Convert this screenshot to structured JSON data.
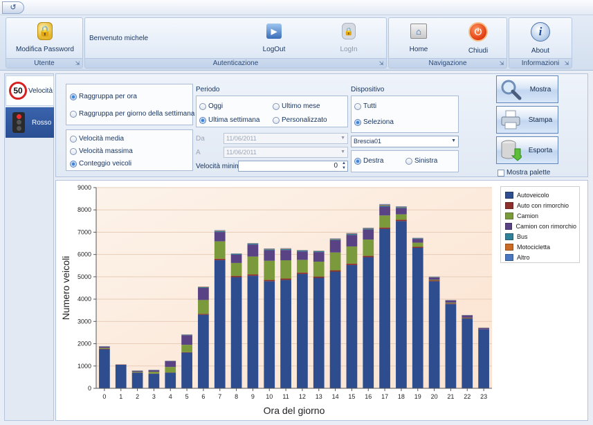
{
  "ribbon": {
    "groups": {
      "utente": "Utente",
      "autenticazione": "Autenticazione",
      "navigazione": "Navigazione",
      "informazioni": "Informazioni"
    },
    "buttons": {
      "modifica_password": "Modifica Password",
      "logout": "LogOut",
      "login": "LogIn",
      "home": "Home",
      "chiudi": "Chiudi",
      "about": "About"
    },
    "welcome": "Benvenuto michele"
  },
  "nav": {
    "velocita": "Velocità",
    "sign_value": "50",
    "rosso": "Rosso"
  },
  "filters": {
    "grouping": {
      "per_ora": "Raggruppa per ora",
      "per_giorno": "Raggruppa per giorno della settimana",
      "selected": "per_ora"
    },
    "metric": {
      "velocita_media": "Velocità media",
      "velocita_massima": "Velocità massima",
      "conteggio_veicoli": "Conteggio veicoli",
      "selected": "conteggio_veicoli"
    },
    "periodo": {
      "title": "Periodo",
      "oggi": "Oggi",
      "ultimo_mese": "Ultimo mese",
      "ultima_settimana": "Ultima settimana",
      "personalizzato": "Personalizzato",
      "selected": "ultima_settimana",
      "da_label": "Da",
      "a_label": "A",
      "da_value": "11/06/2011",
      "a_value": "11/06/2011",
      "velocita_minima_label": "Velocità minima",
      "velocita_minima_value": "0"
    },
    "dispositivo": {
      "title": "Dispositivo",
      "tutti": "Tutti",
      "seleziona": "Seleziona",
      "selected": "seleziona",
      "device_value": "Brescia01",
      "destra": "Destra",
      "sinistra": "Sinistra",
      "direction_selected": "destra"
    }
  },
  "actions": {
    "mostra": "Mostra",
    "stampa": "Stampa",
    "esporta": "Esporta",
    "mostra_palette": "Mostra palette"
  },
  "colors": {
    "autoveicolo": "#2e4d8f",
    "auto_con_rimorchio": "#8c2f2a",
    "camion": "#7b9a3c",
    "camion_con_rimorchio": "#5a4384",
    "bus": "#2f7f96",
    "motocicletta": "#c96a25",
    "altro": "#4a78c0"
  },
  "chart_data": {
    "type": "bar",
    "stacked": true,
    "xlabel": "Ora del giorno",
    "ylabel": "Numero veicoli",
    "ylim": [
      0,
      9000
    ],
    "yticks": [
      0,
      1000,
      2000,
      3000,
      4000,
      5000,
      6000,
      7000,
      8000,
      9000
    ],
    "categories": [
      "0",
      "1",
      "2",
      "3",
      "4",
      "5",
      "6",
      "7",
      "8",
      "9",
      "10",
      "11",
      "12",
      "13",
      "14",
      "15",
      "16",
      "17",
      "18",
      "19",
      "20",
      "21",
      "22",
      "23"
    ],
    "grid": true,
    "legend": "top-right",
    "series": [
      {
        "name": "Autoveicolo",
        "values": [
          1750,
          1060,
          700,
          650,
          700,
          1600,
          3300,
          5750,
          4980,
          5050,
          4800,
          4860,
          5130,
          4950,
          5230,
          5530,
          5880,
          7150,
          7500,
          6300,
          4800,
          3780,
          3130,
          2650
        ]
      },
      {
        "name": "Auto con rimorchio",
        "values": [
          20,
          10,
          10,
          10,
          10,
          20,
          40,
          60,
          60,
          60,
          60,
          60,
          60,
          60,
          60,
          60,
          60,
          60,
          60,
          50,
          40,
          30,
          20,
          10
        ]
      },
      {
        "name": "Camion",
        "values": [
          40,
          0,
          30,
          80,
          250,
          330,
          620,
          780,
          580,
          800,
          860,
          820,
          570,
          670,
          800,
          770,
          730,
          540,
          240,
          180,
          30,
          30,
          20,
          0
        ]
      },
      {
        "name": "Camion con rimorchio",
        "values": [
          60,
          0,
          40,
          70,
          260,
          430,
          540,
          420,
          370,
          540,
          470,
          460,
          380,
          430,
          550,
          520,
          450,
          400,
          280,
          170,
          100,
          100,
          100,
          40
        ]
      },
      {
        "name": "Bus",
        "values": [
          10,
          0,
          10,
          10,
          10,
          20,
          30,
          40,
          40,
          40,
          40,
          40,
          40,
          40,
          40,
          40,
          40,
          50,
          40,
          30,
          20,
          10,
          10,
          10
        ]
      },
      {
        "name": "Motocicletta",
        "values": [
          5,
          0,
          5,
          5,
          5,
          10,
          20,
          20,
          10,
          10,
          20,
          20,
          10,
          10,
          20,
          20,
          20,
          30,
          20,
          10,
          10,
          5,
          5,
          5
        ]
      },
      {
        "name": "Altro",
        "values": [
          5,
          0,
          5,
          5,
          5,
          10,
          10,
          20,
          10,
          10,
          20,
          20,
          10,
          10,
          20,
          20,
          20,
          30,
          20,
          10,
          10,
          5,
          5,
          5
        ]
      }
    ]
  }
}
